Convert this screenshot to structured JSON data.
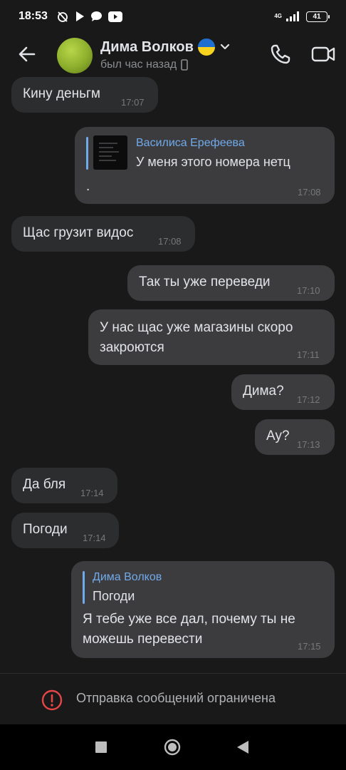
{
  "status_bar": {
    "time": "18:53",
    "network": "4G",
    "battery": "41"
  },
  "header": {
    "name": "Дима Волков",
    "last_seen": "был час назад"
  },
  "messages": [
    {
      "direction": "in",
      "text": "Кину деньгм",
      "time": "17:07"
    },
    {
      "direction": "out",
      "reply_name": "Василиса Ерефеева",
      "reply_text": "У меня этого номера нетц",
      "text": ".",
      "time": "17:08"
    },
    {
      "direction": "in",
      "text": "Щас грузит видос",
      "time": "17:08"
    },
    {
      "direction": "out",
      "text": "Так ты уже переведи",
      "time": "17:10"
    },
    {
      "direction": "out",
      "text": "У нас щас уже магазины скоро закроются",
      "time": "17:11"
    },
    {
      "direction": "out",
      "text": "Дима?",
      "time": "17:12"
    },
    {
      "direction": "out",
      "text": "Ау?",
      "time": "17:13"
    },
    {
      "direction": "in",
      "text": "Да бля",
      "time": "17:14"
    },
    {
      "direction": "in",
      "text": "Погоди",
      "time": "17:14"
    },
    {
      "direction": "out",
      "reply_name": "Дима Волков",
      "reply_text": "Погоди",
      "text": "Я тебе уже все дал, почему ты не можешь перевести",
      "time": "17:15"
    }
  ],
  "footer": {
    "restricted_text": "Отправка сообщений ограничена"
  },
  "colors": {
    "background": "#191919",
    "bubble_in": "#2c2d2e",
    "bubble_out": "#3c3c3e",
    "accent": "#71aaeb",
    "warning": "#e64646"
  },
  "icons": [
    "back-arrow-icon",
    "chevron-down-icon",
    "phone-icon",
    "video-camera-icon",
    "warning-icon",
    "recents-icon",
    "home-icon",
    "back-nav-icon"
  ]
}
